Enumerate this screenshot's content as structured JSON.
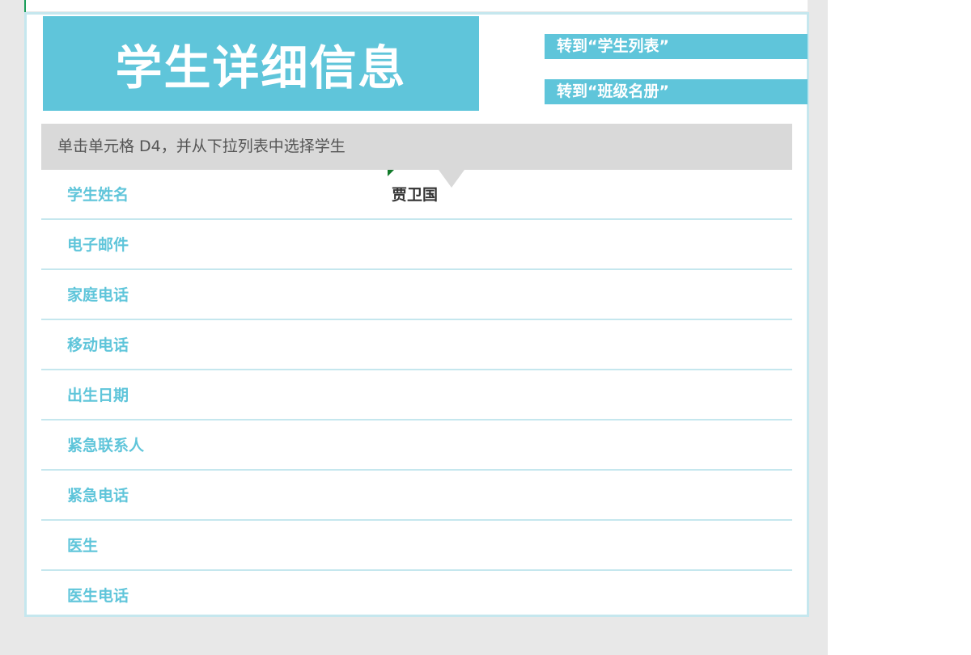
{
  "title": "学生详细信息",
  "nav_links": [
    {
      "label": "转到“学生列表”"
    },
    {
      "label": "转到“班级名册”"
    }
  ],
  "instruction": "单击单元格 D4，并从下拉列表中选择学生",
  "rows": [
    {
      "label": "学生姓名",
      "value": "贾卫国"
    },
    {
      "label": "电子邮件",
      "value": ""
    },
    {
      "label": "家庭电话",
      "value": ""
    },
    {
      "label": "移动电话",
      "value": ""
    },
    {
      "label": "出生日期",
      "value": ""
    },
    {
      "label": "紧急联系人",
      "value": ""
    },
    {
      "label": "紧急电话",
      "value": ""
    },
    {
      "label": "医生",
      "value": ""
    },
    {
      "label": "医生电话",
      "value": ""
    }
  ],
  "colors": {
    "accent": "#5fc5da",
    "border": "#c5e7ee",
    "instruction_bg": "#d9d9d9",
    "sheet_bg": "#e8e8e8"
  }
}
